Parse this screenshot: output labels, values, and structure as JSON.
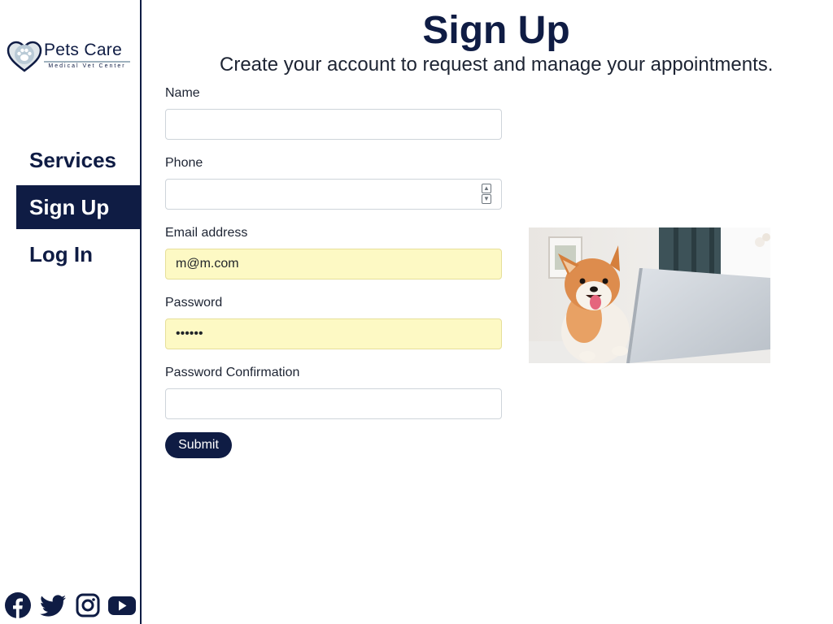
{
  "brand": {
    "name": "Pets Care",
    "tagline": "Medical Vet Center"
  },
  "nav": {
    "items": [
      {
        "label": "Services",
        "active": false
      },
      {
        "label": "Sign Up",
        "active": true
      },
      {
        "label": "Log In",
        "active": false
      }
    ]
  },
  "social": [
    "facebook-icon",
    "twitter-icon",
    "instagram-icon",
    "youtube-icon"
  ],
  "page": {
    "title": "Sign Up",
    "subtitle": "Create your account to request and manage your appointments."
  },
  "form": {
    "name": {
      "label": "Name",
      "value": ""
    },
    "phone": {
      "label": "Phone",
      "value": ""
    },
    "email": {
      "label": "Email address",
      "value": "m@m.com"
    },
    "password": {
      "label": "Password",
      "value": "••••••"
    },
    "password_confirmation": {
      "label": "Password Confirmation",
      "value": ""
    },
    "submit_label": "Submit"
  },
  "image": {
    "subject": "dog-with-laptop"
  },
  "colors": {
    "brand_navy": "#0f1c44",
    "autofill_yellow": "#fdf9c4",
    "border": "#ced4da"
  }
}
